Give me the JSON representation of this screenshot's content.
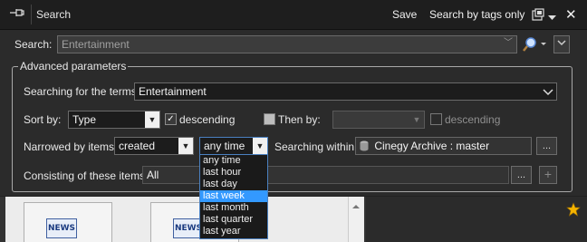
{
  "titlebar": {
    "title": "Search",
    "save_label": "Save",
    "search_by_tags_label": "Search by tags only",
    "close_symbol": "✕",
    "pin_icon": "pin-icon"
  },
  "search": {
    "label": "Search:",
    "value": "Entertainment"
  },
  "advanced": {
    "group_label": "Advanced parameters",
    "terms_label": "Searching for the terms:",
    "terms_value": "Entertainment",
    "sort_label": "Sort by:",
    "sort_value": "Type",
    "descending_label": "descending",
    "descending_checked": true,
    "then_by_label": "Then by:",
    "then_by_checked": false,
    "then_by_value": "",
    "then_descending_label": "descending",
    "then_descending_checked": false,
    "narrowed_label": "Narrowed by items:",
    "narrowed_value": "created",
    "time_value": "any time",
    "within_label": "Searching within:",
    "within_value": "Cinegy Archive : master",
    "browse_label": "...",
    "consisting_label": "Consisting of these items:",
    "consisting_value": "All",
    "browse2_label": "...",
    "add_label": "+"
  },
  "time_options": [
    "any time",
    "last hour",
    "last day",
    "last week",
    "last month",
    "last quarter",
    "last year"
  ],
  "time_selected_index": 3,
  "results": {
    "news_label": "NEWS"
  }
}
